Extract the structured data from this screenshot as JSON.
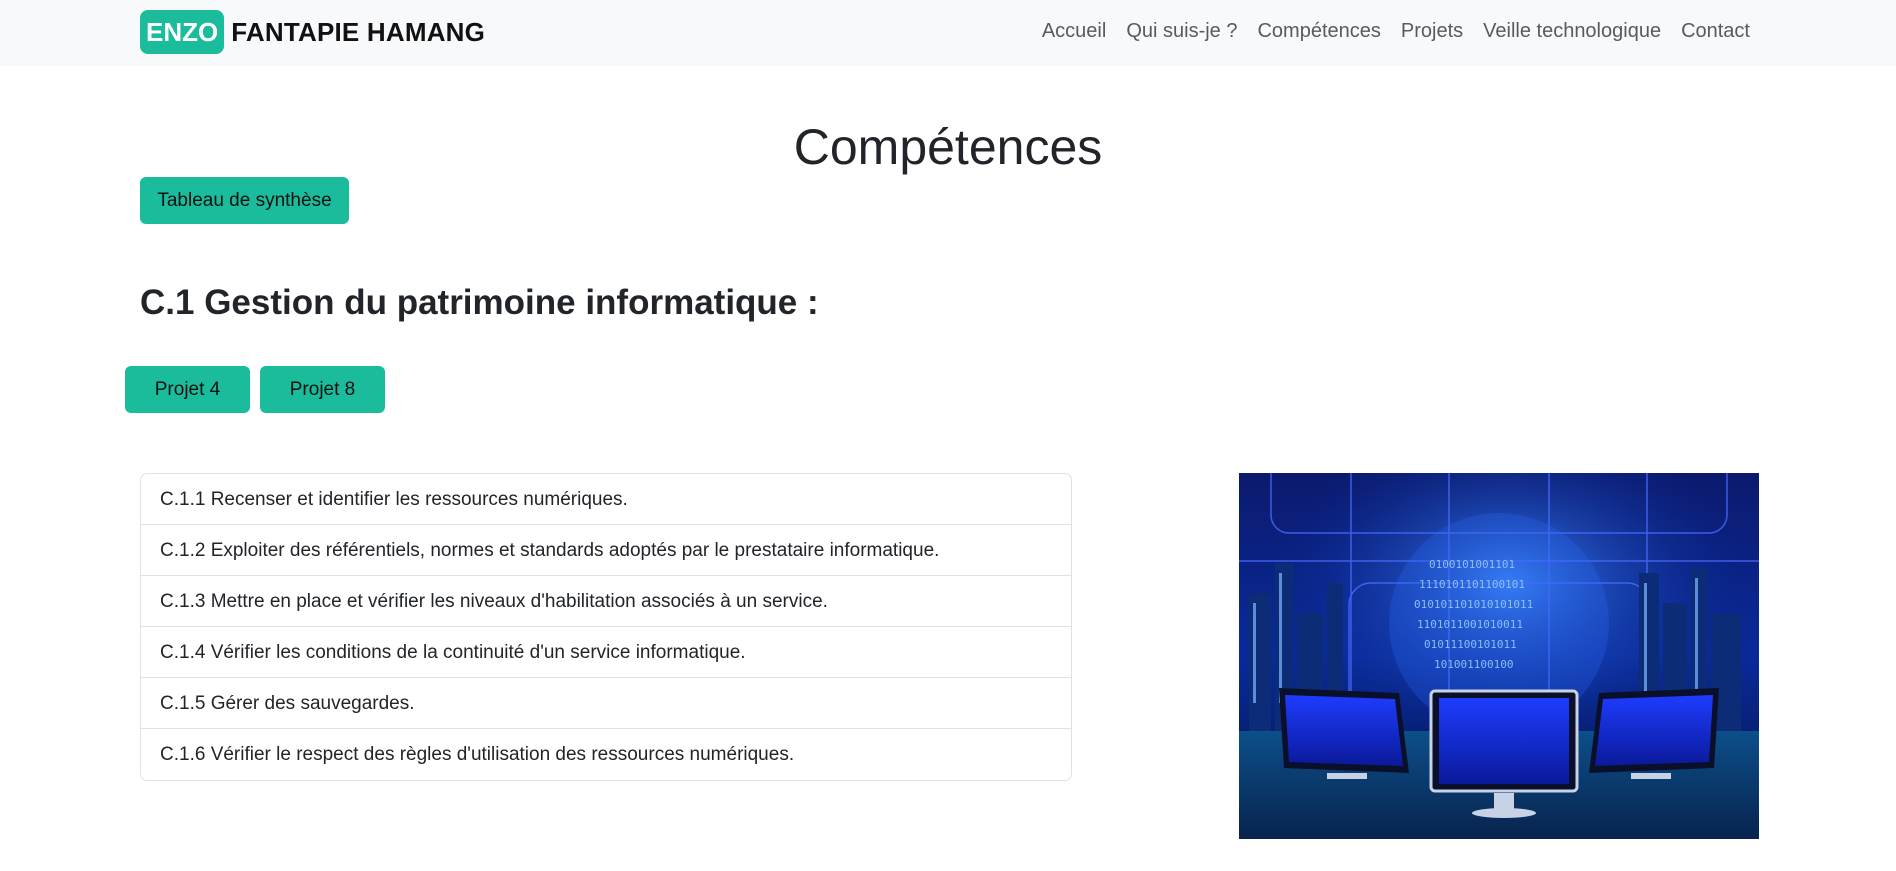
{
  "brand": {
    "badge": "ENZO",
    "name": "FANTAPIE HAMANG"
  },
  "nav": {
    "links": [
      "Accueil",
      "Qui suis-je ?",
      "Compétences",
      "Projets",
      "Veille technologique",
      "Contact"
    ]
  },
  "page": {
    "title": "Compétences"
  },
  "buttons": {
    "synthese": "Tableau de synthèse",
    "projet4": "Projet 4",
    "projet8": "Projet 8"
  },
  "section": {
    "title": "C.1 Gestion du patrimoine informatique :",
    "items": [
      "C.1.1 Recenser et identifier les ressources numériques.",
      "C.1.2 Exploiter des référentiels, normes et standards adoptés par le prestataire informatique.",
      "C.1.3 Mettre en place et vérifier les niveaux d'habilitation associés à un service.",
      "C.1.4 Vérifier les conditions de la continuité d'un service informatique.",
      "C.1.5 Gérer des sauvegardes.",
      "C.1.6 Vérifier le respect des règles d'utilisation des ressources numériques."
    ]
  },
  "image": {
    "icon": "digital-city-computers-illustration"
  },
  "colors": {
    "accent": "#1abc9c",
    "navbar_bg": "#f8f9fa",
    "text": "#212529"
  }
}
